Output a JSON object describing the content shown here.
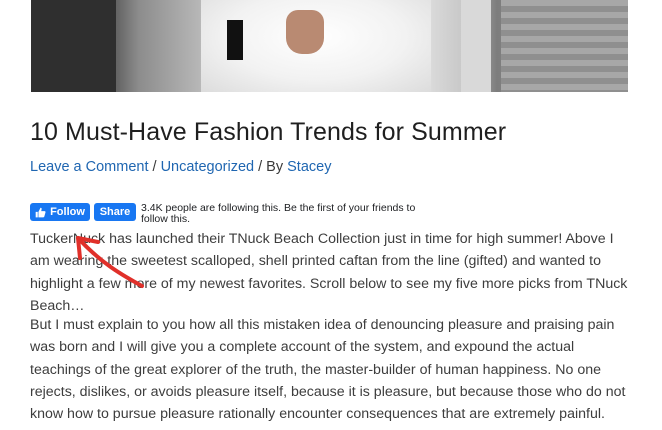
{
  "post": {
    "title": "10 Must-Have Fashion Trends for Summer",
    "meta": {
      "comment_link": "Leave a Comment",
      "separator1": " / ",
      "category_link": "Uncategorized",
      "separator2": " / By ",
      "author_link": "Stacey"
    }
  },
  "facebook": {
    "follow_label": "Follow",
    "share_label": "Share",
    "followers_text": "3.4K people are following this. Be the first of your friends to follow this.",
    "brand_color": "#1877f2"
  },
  "body": {
    "paragraph1": "TuckerNuck has launched their TNuck Beach Collection just in time for high summer! Above I am wearing the sweetest scalloped, shell printed caftan from the line (gifted) and wanted to highlight a few more of my newest favorites. Scroll below to see my five more picks from TNuck Beach…",
    "paragraph2": "But I must explain to you how all this mistaken idea of denouncing pleasure and praising pain was born and I will give you a complete account of the system, and expound the actual teachings of the great explorer of the truth, the master-builder of human happiness. No one rejects, dislikes, or avoids pleasure itself, because it is pleasure, but because those who do not know how to pursue pleasure rationally encounter consequences that are extremely painful."
  },
  "annotation": {
    "arrow_color": "#e0302a"
  }
}
